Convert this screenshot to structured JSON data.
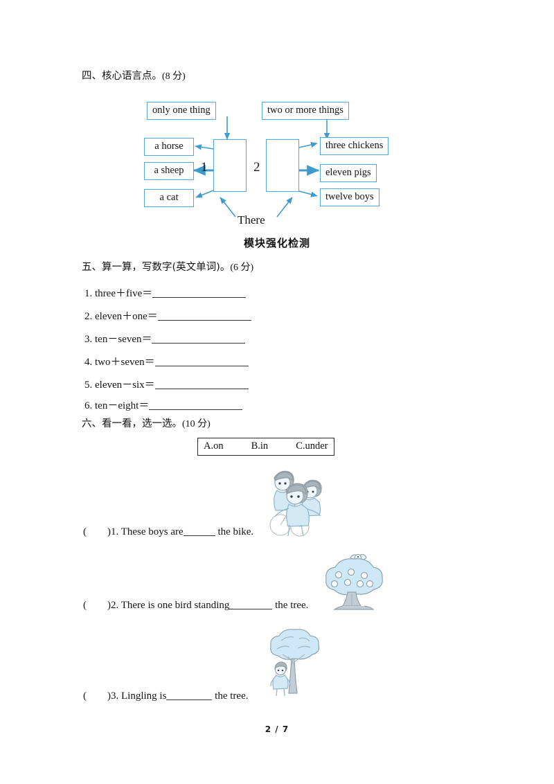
{
  "page": {
    "footer": "2 / 7",
    "module_title": "模块强化检测"
  },
  "sections": {
    "four": {
      "heading": "四、核心语言点。",
      "score": "(8 分)",
      "diagram": {
        "top_labels": [
          {
            "text": "only one thing"
          },
          {
            "text": "two or more things"
          }
        ],
        "box_numbers": [
          "1",
          "2"
        ],
        "left_labels": [
          {
            "text": "a horse"
          },
          {
            "text": "a sheep"
          },
          {
            "text": "a cat"
          }
        ],
        "right_labels": [
          {
            "text": "three chickens"
          },
          {
            "text": "eleven pigs"
          },
          {
            "text": "twelve boys"
          }
        ],
        "bottom_label": "There"
      }
    },
    "five": {
      "heading": "五、算一算，写数字(英文单词)。",
      "score": "(6 分)",
      "items": [
        {
          "text": "1. three＋five＝"
        },
        {
          "text": "2. eleven＋one＝"
        },
        {
          "text": "3. ten－seven＝"
        },
        {
          "text": "4. two＋seven＝"
        },
        {
          "text": "5. eleven－six＝"
        },
        {
          "text": "6. ten－eight＝"
        }
      ]
    },
    "six": {
      "heading": "六、看一看，选一选。",
      "score": "(10 分)",
      "options": [
        {
          "text": "A.on"
        },
        {
          "text": "B.in"
        },
        {
          "text": "C.under"
        }
      ],
      "questions": [
        {
          "paren": "(",
          "paren_close": ")",
          "number": "1.",
          "text_before": "These boys are",
          "text_after": "the bike.",
          "picture": "boys-on-bike-illustration"
        },
        {
          "paren": "(",
          "paren_close": ")",
          "number": "2.",
          "text_before": "There is one bird standing",
          "text_after": "the tree.",
          "picture": "bird-on-apple-tree-illustration"
        },
        {
          "paren": "(",
          "paren_close": ")",
          "number": "3.",
          "text_before": "Lingling is",
          "text_after": "the tree.",
          "picture": "girl-under-tree-illustration"
        }
      ]
    }
  },
  "colors": {
    "diagram_border": "#53a7d4",
    "diagram_arrow": "#3f9bcd",
    "illustration_fill": "#cfe6f4",
    "illustration_stroke": "#8aa0ab",
    "text": "#141414"
  }
}
